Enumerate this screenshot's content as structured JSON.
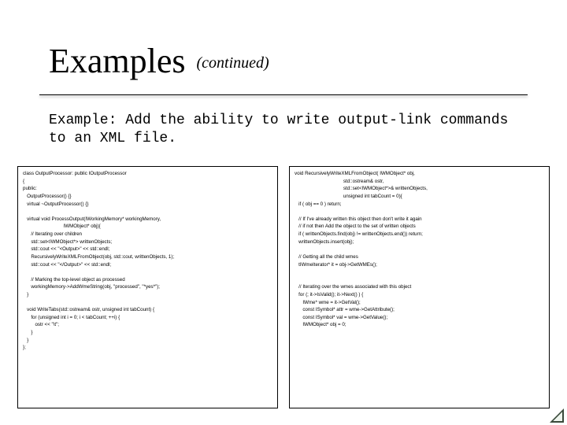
{
  "title": {
    "main": "Examples",
    "sub": "(continued)"
  },
  "subtitle": "Example: Add the ability to write output-link\n  commands to an XML file.",
  "code": {
    "left": "class OutputProcessor: public IOutputProcessor\n{\npublic:\n   OutputProcessor() {}\n   virtual ~OutputProcessor() {}\n\n   virtual void ProcessOutput(IWorkingMemory* workingMemory,\n                              IWMObject* obj){\n      // Iterating over children\n      std::set<IWMObject*> writtenObjects;\n      std::cout << \"<Output>\" << std::endl;\n      RecursivelyWriteXMLFromObject(obj, std::cout, writtenObjects, 1);\n      std::cout << \"</Output>\" << std::endl;\n\n      // Marking the top-level object as processed\n      workingMemory->AddWmeString(obj, \"processed\", \"*yes*\");\n   }\n\n   void WriteTabs(std::ostream& ostr, unsigned int tabCount) {\n      for (unsigned int i = 0; i < tabCount; ++i) {\n         ostr << \"\\t\";\n      }\n   }\n};",
    "right": "void RecursivelyWriteXMLFromObject( IWMObject* obj,\n                                    std::ostream& ostr,\n                                    std::set<IWMObject*>& writtenObjects,\n                                    unsigned int tabCount = 0){\n   if ( obj == 0 ) return;\n\n   // If I've already written this object then don't write it again\n   // if not then Add the object to the set of written objects\n   if ( writtenObjects.find(obj) != writtenObjects.end()) return;\n   writtenObjects.insert(obj);\n\n   // Getting all the child wmes\n   tIWmeIterator* it = obj->GetWMEs();\n\n\n   // Iterating over the wmes associated with this object\n   for (; it->IsValid(); it->Next() ) {\n      IWme* wme = it->GetVal();\n      const ISymbol* attr = wme->GetAttribute();\n      const ISymbol* val = wme->GetValue();\n      IWMObject* obj = 0;"
  }
}
